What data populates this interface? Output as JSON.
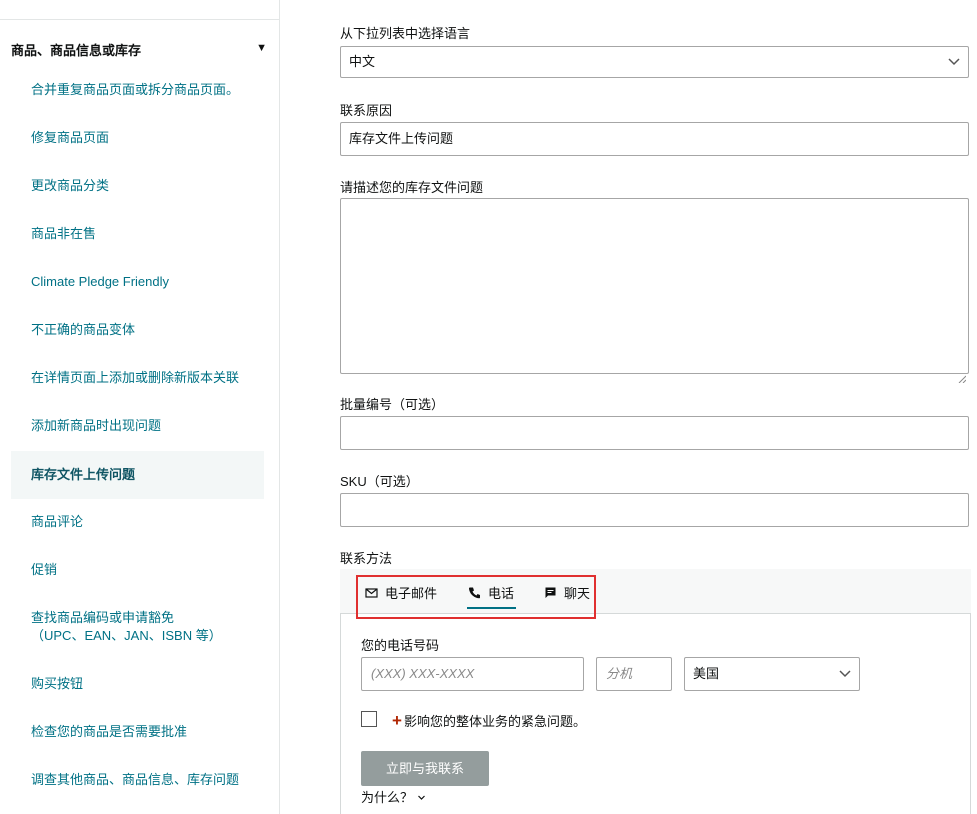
{
  "sidebar": {
    "section_title": "商品、商品信息或库存",
    "items": [
      {
        "label": "合并重复商品页面或拆分商品页面。"
      },
      {
        "label": "修复商品页面"
      },
      {
        "label": "更改商品分类"
      },
      {
        "label": "商品非在售"
      },
      {
        "label": "Climate Pledge Friendly"
      },
      {
        "label": "不正确的商品变体"
      },
      {
        "label": "在详情页面上添加或删除新版本关联"
      },
      {
        "label": "添加新商品时出现问题"
      },
      {
        "label": "库存文件上传问题",
        "active": true
      },
      {
        "label": "商品评论"
      },
      {
        "label": "促销"
      },
      {
        "label": "查找商品编码或申请豁免（UPC、EAN、JAN、ISBN 等）"
      },
      {
        "label": "购买按钮"
      },
      {
        "label": "检查您的商品是否需要批准"
      },
      {
        "label": "调查其他商品、商品信息、库存问题"
      }
    ]
  },
  "form": {
    "language_label": "从下拉列表中选择语言",
    "language_value": "中文",
    "reason_label": "联系原因",
    "reason_value": "库存文件上传问题",
    "description_label": "请描述您的库存文件问题",
    "description_value": "",
    "batch_label": "批量编号（可选）",
    "batch_value": "",
    "sku_label": "SKU（可选）",
    "sku_value": "",
    "contact_method_label": "联系方法"
  },
  "contact": {
    "tabs": [
      {
        "label": "电子邮件",
        "icon": "mail-icon"
      },
      {
        "label": "电话",
        "icon": "phone-icon",
        "active": true
      },
      {
        "label": "聊天",
        "icon": "chat-icon"
      }
    ],
    "phone_label": "您的电话号码",
    "phone_placeholder": "(XXX) XXX-XXXX",
    "ext_placeholder": "分机",
    "country_value": "美国",
    "urgent_label": "影响您的整体业务的紧急问题。",
    "submit_label": "立即与我联系",
    "why_label": "为什么？"
  },
  "colors": {
    "link": "#007185",
    "active_bg": "#f3f7f7",
    "button_bg": "#949d9d",
    "highlight_box": "#e03030",
    "urgent_plus": "#b12704"
  }
}
